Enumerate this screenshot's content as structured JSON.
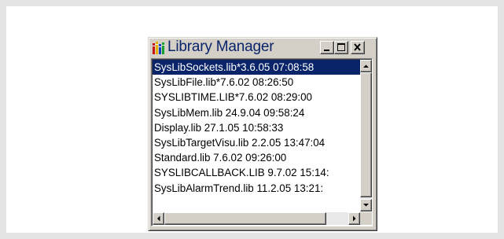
{
  "window": {
    "title": "Library Manager",
    "app_icon": "library-books-icon",
    "controls": [
      "minimize-icon",
      "maximize-icon",
      "close-icon"
    ]
  },
  "libraries": [
    "SysLibSockets.lib*3.6.05 07:08:58",
    "SysLibFile.lib*7.6.02 08:26:50",
    "SYSLIBTIME.LIB*7.6.02 08:29:00",
    "SysLibMem.lib 24.9.04 09:58:24",
    "Display.lib 27.1.05 10:58:33",
    "SysLibTargetVisu.lib 2.2.05 13:47:04",
    "Standard.lib 7.6.02 09:26:00",
    "SYSLIBCALLBACK.LIB 9.7.02 15:14:",
    "SysLibAlarmTrend.lib 11.2.05 13:21:"
  ],
  "selected_index": 0,
  "colors": {
    "selection": "#0a246a",
    "title_text": "#0a246a",
    "window_face": "#d4d0c8"
  }
}
